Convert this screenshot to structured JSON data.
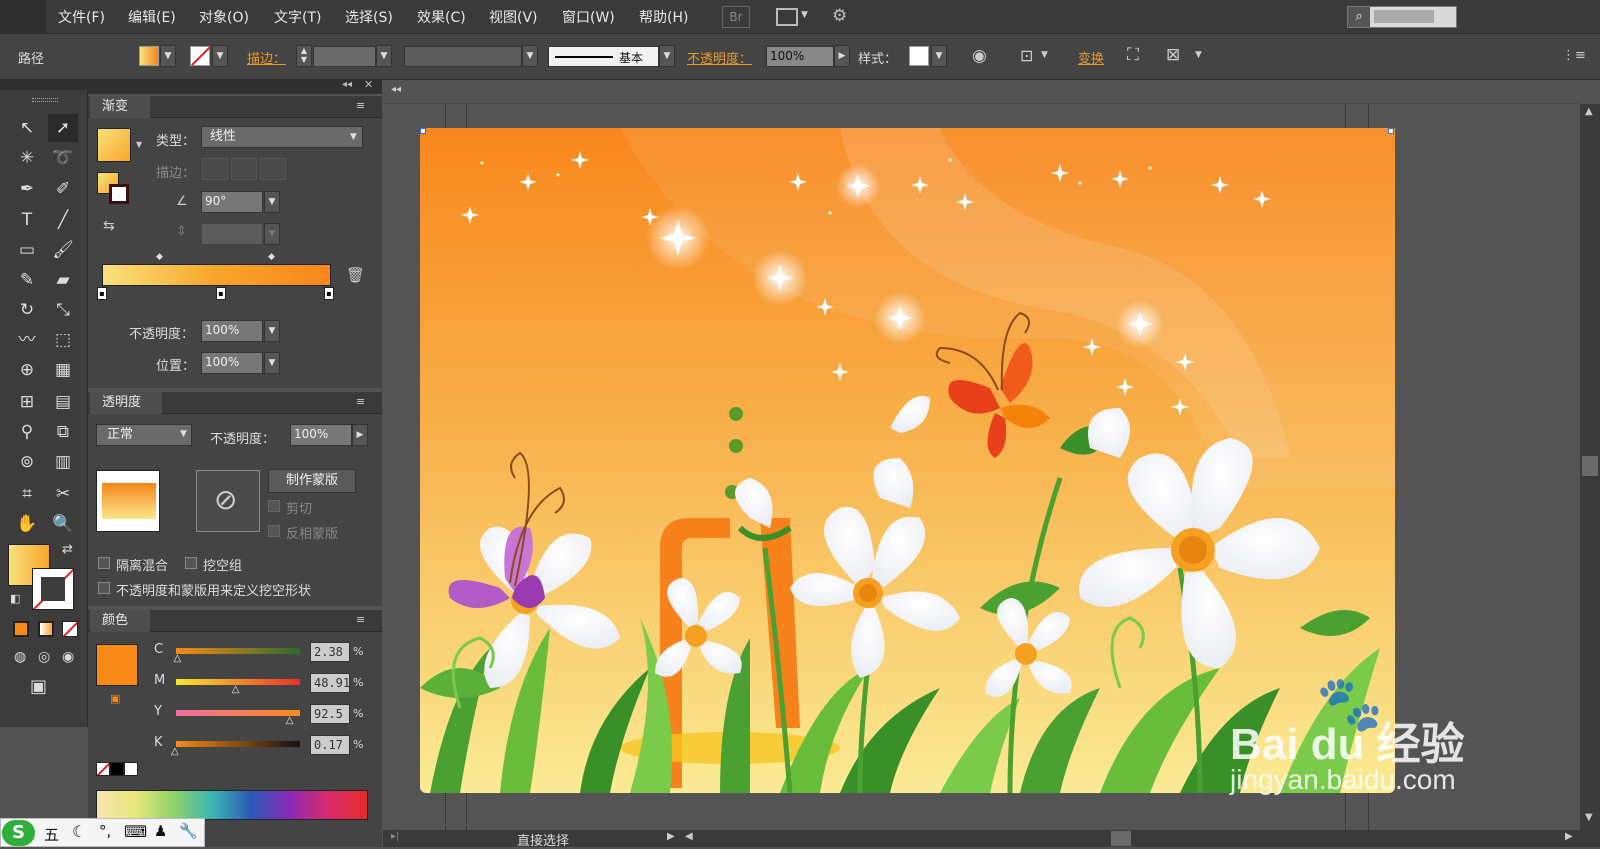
{
  "menu": {
    "items": [
      "文件(F)",
      "编辑(E)",
      "对象(O)",
      "文字(T)",
      "选择(S)",
      "效果(C)",
      "视图(V)",
      "窗口(W)",
      "帮助(H)"
    ],
    "bridge": "Br"
  },
  "control": {
    "object_label": "路径",
    "stroke_label": "描边：",
    "brush_label": "基本",
    "opacity_label": "不透明度：",
    "opacity_value": "100%",
    "style_label": "样式：",
    "transform_label": "变换"
  },
  "gradient_panel": {
    "title": "渐变",
    "type_label": "类型：",
    "type_value": "线性",
    "stroke_label": "描边：",
    "angle_value": "90°",
    "opacity_label": "不透明度：",
    "opacity_value": "100%",
    "position_label": "位置：",
    "position_value": "100%",
    "colors": {
      "start": "#f9e27c",
      "end": "#f8871c"
    }
  },
  "transparency_panel": {
    "title": "透明度",
    "blend_mode": "正常",
    "opacity_label": "不透明度：",
    "opacity_value": "100%",
    "make_mask_label": "制作蒙版",
    "clip_label": "剪切",
    "invert_mask_label": "反相蒙版",
    "isolate_label": "隔离混合",
    "knockout_label": "挖空组",
    "opacity_mask_label": "不透明度和蒙版用来定义挖空形状"
  },
  "color_panel": {
    "title": "颜色",
    "current_color": "#f88a17",
    "channels": [
      {
        "name": "C",
        "value": "2.38",
        "fraction": 0.02
      },
      {
        "name": "M",
        "value": "48.91",
        "fraction": 0.49
      },
      {
        "name": "Y",
        "value": "92.5",
        "fraction": 0.925
      },
      {
        "name": "K",
        "value": "0.17",
        "fraction": 0.0
      }
    ],
    "unit": "%"
  },
  "status": {
    "tool": "直接选择"
  },
  "ime": {
    "mode": "五"
  },
  "watermark": {
    "brand": "Bai du 经验",
    "url": "jingyan.baidu.com"
  }
}
